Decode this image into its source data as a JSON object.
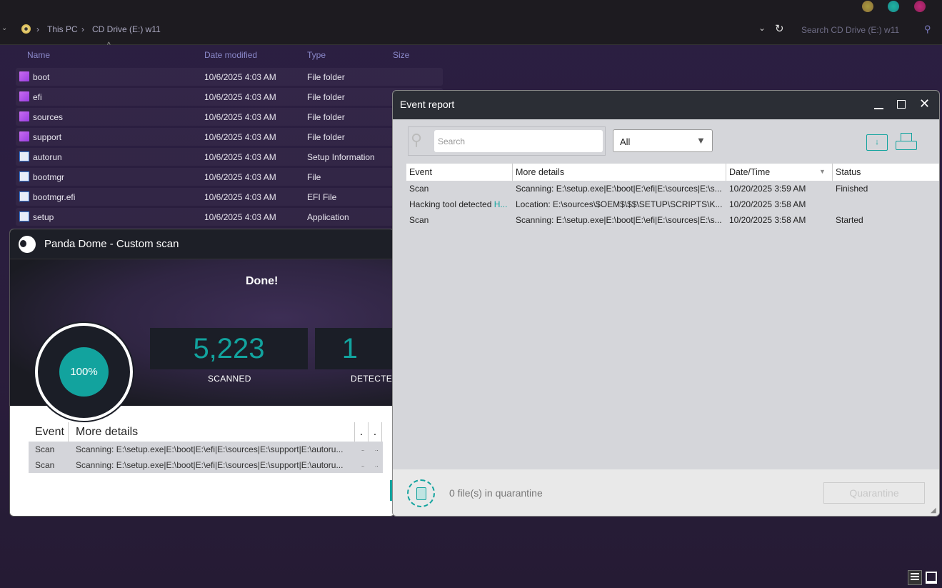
{
  "explorer": {
    "breadcrumb": [
      "This PC",
      "CD Drive (E:) w11"
    ],
    "search_placeholder": "Search CD Drive (E:) w11",
    "columns": [
      "Name",
      "Date modified",
      "Type",
      "Size"
    ],
    "files": [
      {
        "name": "boot",
        "date": "10/6/2025 4:03 AM",
        "type": "File folder",
        "icon": "folder"
      },
      {
        "name": "efi",
        "date": "10/6/2025 4:03 AM",
        "type": "File folder",
        "icon": "folder"
      },
      {
        "name": "sources",
        "date": "10/6/2025 4:03 AM",
        "type": "File folder",
        "icon": "folder"
      },
      {
        "name": "support",
        "date": "10/6/2025 4:03 AM",
        "type": "File folder",
        "icon": "folder"
      },
      {
        "name": "autorun",
        "date": "10/6/2025 4:03 AM",
        "type": "Setup Information",
        "icon": "settings-file"
      },
      {
        "name": "bootmgr",
        "date": "10/6/2025 4:03 AM",
        "type": "File",
        "icon": "system-file"
      },
      {
        "name": "bootmgr.efi",
        "date": "10/6/2025 4:03 AM",
        "type": "EFI File",
        "icon": "system-file"
      },
      {
        "name": "setup",
        "date": "10/6/2025 4:03 AM",
        "type": "Application",
        "icon": "setup-app"
      }
    ]
  },
  "panda": {
    "title": "Panda Dome - Custom scan",
    "status": "Done!",
    "progress": "100%",
    "scanned_value": "5,223",
    "scanned_label": "SCANNED",
    "detected_value": "1",
    "detected_label": "DETECTED",
    "table": {
      "headers": [
        "Event",
        "More details",
        ".",
        "."
      ],
      "rows": [
        {
          "event": "Scan",
          "details": "Scanning: E:\\setup.exe|E:\\boot|E:\\efi|E:\\sources|E:\\support|E:\\autoru...",
          "c3": "..",
          "c4": ".."
        },
        {
          "event": "Scan",
          "details": "Scanning: E:\\setup.exe|E:\\boot|E:\\efi|E:\\sources|E:\\support|E:\\autoru...",
          "c3": "..",
          "c4": ".."
        }
      ]
    }
  },
  "event_report": {
    "title": "Event report",
    "search_placeholder": "Search",
    "filter_value": "All",
    "headers": [
      "Event",
      "More details",
      "Date/Time",
      "Status"
    ],
    "rows": [
      {
        "event": "Scan",
        "event_link": "",
        "details": "Scanning: E:\\setup.exe|E:\\boot|E:\\efi|E:\\sources|E:\\s...",
        "date": "10/20/2025 3:59 AM",
        "status": "Finished"
      },
      {
        "event": "Hacking tool detected ",
        "event_link": "H...",
        "details": "Location: E:\\sources\\$OEM$\\$$\\SETUP\\SCRIPTS\\K...",
        "date": "10/20/2025 3:58 AM",
        "status": ""
      },
      {
        "event": "Scan",
        "event_link": "",
        "details": "Scanning: E:\\setup.exe|E:\\boot|E:\\efi|E:\\sources|E:\\s...",
        "date": "10/20/2025 3:58 AM",
        "status": "Started"
      }
    ],
    "quarantine_text": "0 file(s) in quarantine",
    "quarantine_button": "Quarantine"
  },
  "colors": {
    "teal": "#12a39e"
  }
}
